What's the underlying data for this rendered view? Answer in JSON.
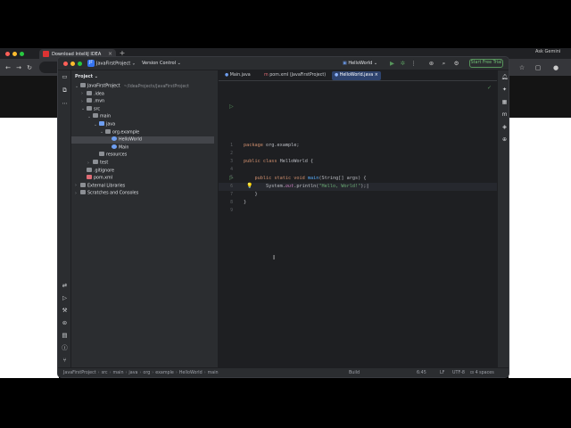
{
  "browser": {
    "tab_title": "Download IntelliJ IDEA",
    "new_tab": "+",
    "profile": "Ask Gemini"
  },
  "ide": {
    "project_badge": "JF",
    "project_name": "JavaFirstProject",
    "vcs": "Version Control",
    "run_config": "HelloWorld",
    "trial_button": "Start Free Trial",
    "panel_title": "Project",
    "tree": [
      {
        "label": "JavaFirstProject",
        "extra": "~/IdeaProjects/JavaFirstProject",
        "level": 0,
        "chev": "v",
        "icon": "folder"
      },
      {
        "label": ".idea",
        "level": 1,
        "chev": ">",
        "icon": "folder"
      },
      {
        "label": ".mvn",
        "level": 1,
        "chev": ">",
        "icon": "folder"
      },
      {
        "label": "src",
        "level": 1,
        "chev": "v",
        "icon": "folder"
      },
      {
        "label": "main",
        "level": 2,
        "chev": "v",
        "icon": "folder"
      },
      {
        "label": "java",
        "level": 3,
        "chev": "v",
        "icon": "folder-blue"
      },
      {
        "label": "org.example",
        "level": 4,
        "chev": "v",
        "icon": "package"
      },
      {
        "label": "HelloWorld",
        "level": 5,
        "chev": "",
        "icon": "class",
        "selected": true
      },
      {
        "label": "Main",
        "level": 5,
        "chev": "",
        "icon": "class"
      },
      {
        "label": "resources",
        "level": 3,
        "chev": "",
        "icon": "folder"
      },
      {
        "label": "test",
        "level": 2,
        "chev": ">",
        "icon": "folder"
      },
      {
        "label": ".gitignore",
        "level": 1,
        "chev": "",
        "icon": "file"
      },
      {
        "label": "pom.xml",
        "level": 1,
        "chev": "",
        "icon": "maven"
      },
      {
        "label": "External Libraries",
        "level": 0,
        "chev": ">",
        "icon": "lib"
      },
      {
        "label": "Scratches and Consoles",
        "level": 0,
        "chev": ">",
        "icon": "scratch"
      }
    ],
    "tabs": [
      {
        "label": "Main.java",
        "active": false
      },
      {
        "label": "pom.xml (JavaFirstProject)",
        "active": false
      },
      {
        "label": "HelloWorld.java",
        "active": true
      }
    ],
    "line_numbers": [
      "1",
      "2",
      "3",
      "4",
      "5",
      "6",
      "7",
      "8",
      "9"
    ],
    "code": {
      "l1_kw": "package",
      "l1_rest": " org.example;",
      "l3_kw": "public class",
      "l3_rest": " HelloWorld {",
      "l5_kw": "    public static void",
      "l5_fn": " main",
      "l5_rest": "(String[] args) {",
      "l6_a": "        System.",
      "l6_fld": "out",
      "l6_b": ".println(",
      "l6_str": "\"Hello, World!\"",
      "l6_c": ");",
      "l7": "    }",
      "l8": "}"
    },
    "status": {
      "crumbs": [
        "JavaFirstProject",
        "src",
        "main",
        "java",
        "org",
        "example",
        "HelloWorld",
        "main"
      ],
      "build": "Build",
      "position": "6:45",
      "line_sep": "LF",
      "encoding": "UTF-8",
      "indent": "4 spaces"
    }
  }
}
